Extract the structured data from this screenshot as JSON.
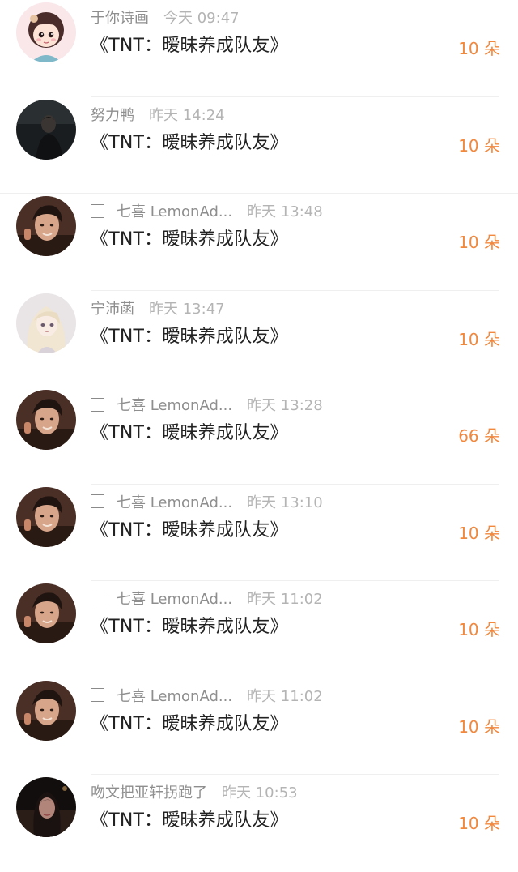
{
  "colors": {
    "amount": "#f0883e",
    "username": "#8e8e8e",
    "time": "#b4b4b4",
    "title": "#222222"
  },
  "items": [
    {
      "avatar": "cartoon-girl-avatar",
      "has_checkbox": false,
      "username": "于你诗画",
      "time": "今天 09:47",
      "title": "《TNT：暧昧养成队友》",
      "amount": "10 朵"
    },
    {
      "avatar": "dark-photo-avatar",
      "has_checkbox": false,
      "username": "努力鸭",
      "time": "昨天 14:24",
      "title": "《TNT：暧昧养成队友》",
      "amount": "10 朵"
    },
    {
      "avatar": "boy-photo-avatar",
      "has_checkbox": true,
      "username": "七喜 LemonAd...",
      "time": "昨天 13:48",
      "title": "《TNT：暧昧养成队友》",
      "amount": "10 朵"
    },
    {
      "avatar": "anime-girl-avatar",
      "has_checkbox": false,
      "username": "宁沛菡",
      "time": "昨天 13:47",
      "title": "《TNT：暧昧养成队友》",
      "amount": "10 朵"
    },
    {
      "avatar": "boy-photo-avatar",
      "has_checkbox": true,
      "username": "七喜 LemonAd...",
      "time": "昨天 13:28",
      "title": "《TNT：暧昧养成队友》",
      "amount": "66 朵"
    },
    {
      "avatar": "boy-photo-avatar",
      "has_checkbox": true,
      "username": "七喜 LemonAd...",
      "time": "昨天 13:10",
      "title": "《TNT：暧昧养成队友》",
      "amount": "10 朵"
    },
    {
      "avatar": "boy-photo-avatar",
      "has_checkbox": true,
      "username": "七喜 LemonAd...",
      "time": "昨天 11:02",
      "title": "《TNT：暧昧养成队友》",
      "amount": "10 朵"
    },
    {
      "avatar": "boy-photo-avatar",
      "has_checkbox": true,
      "username": "七喜 LemonAd...",
      "time": "昨天 11:02",
      "title": "《TNT：暧昧养成队友》",
      "amount": "10 朵"
    },
    {
      "avatar": "dark-woman-avatar",
      "has_checkbox": false,
      "username": "吻文把亚轩拐跑了",
      "time": "昨天 10:53",
      "title": "《TNT：暧昧养成队友》",
      "amount": "10 朵"
    }
  ]
}
